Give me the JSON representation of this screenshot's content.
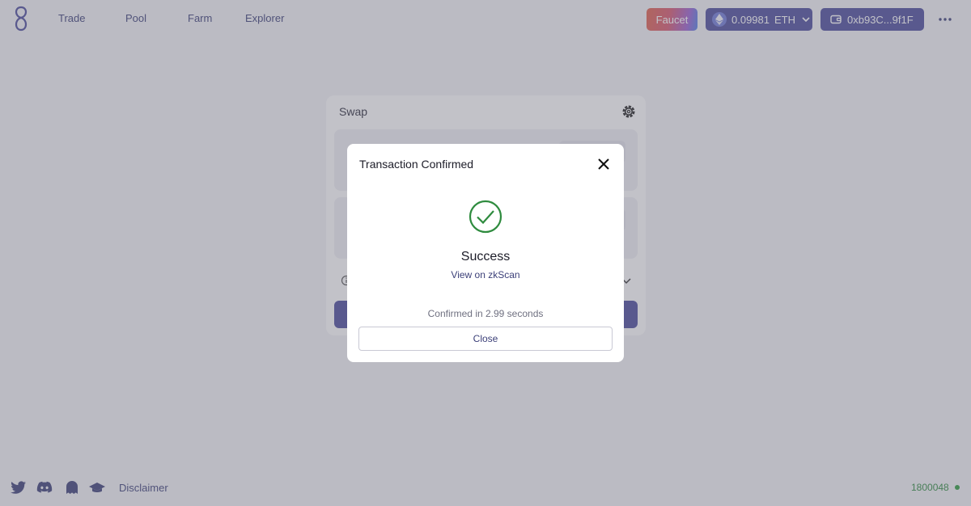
{
  "nav": {
    "links": [
      "Trade",
      "Pool",
      "Farm",
      "Explorer"
    ]
  },
  "header": {
    "faucet_label": "Faucet",
    "eth_balance": "0.09981",
    "eth_symbol": "ETH",
    "wallet_address": "0xb93C...9f1F"
  },
  "swap": {
    "title": "Swap"
  },
  "modal": {
    "title": "Transaction Confirmed",
    "status": "Success",
    "link_label": "View on zkScan",
    "confirmed_text": "Confirmed in 2.99 seconds",
    "close_label": "Close"
  },
  "footer": {
    "disclaimer_label": "Disclaimer",
    "block_number": "1800048"
  },
  "colors": {
    "accent": "#4a4b9c",
    "success": "#2e8b3e",
    "link": "#3b3f78"
  },
  "icons": [
    "logo-icon",
    "ethereum-icon",
    "chevron-down-icon",
    "wallet-icon",
    "more-icon",
    "gear-icon",
    "info-icon",
    "close-icon",
    "check-circle-icon",
    "twitter-icon",
    "discord-icon",
    "ghost-icon",
    "graduation-cap-icon"
  ]
}
